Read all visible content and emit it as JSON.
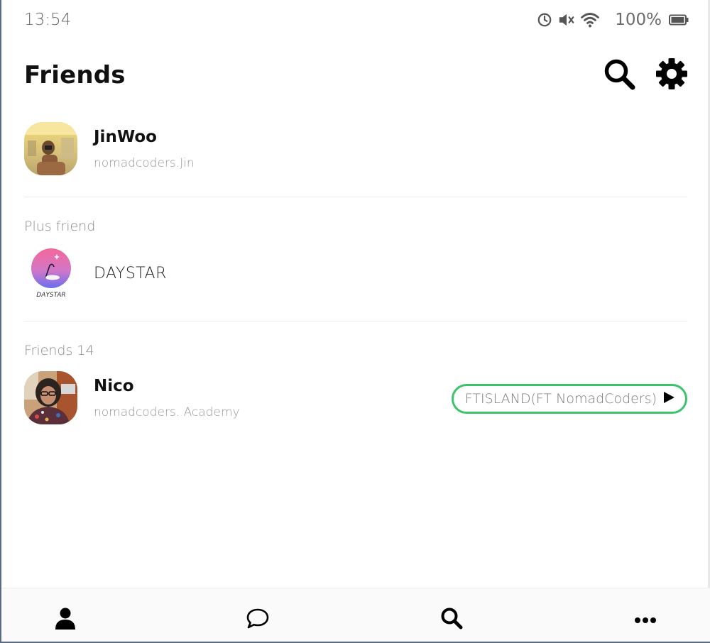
{
  "status_bar": {
    "time": "13:54",
    "battery": "100%",
    "icons": [
      "alarm-icon",
      "mute-icon",
      "wifi-icon",
      "battery-icon"
    ]
  },
  "header": {
    "title": "Friends",
    "actions": [
      "search-icon",
      "gear-icon"
    ]
  },
  "my_profile": {
    "name": "JinWoo",
    "username": "nomadcoders.Jin"
  },
  "plus_friend": {
    "section_title": "Plus friend",
    "items": [
      {
        "name": "DAYSTAR",
        "logo_text": "DAYSTAR"
      }
    ]
  },
  "friends": {
    "section_title": "Friends 14",
    "items": [
      {
        "name": "Nico",
        "status": "nomadcoders. Academy",
        "music": "FTISLAND(FT NomadCoders)"
      }
    ]
  },
  "tab_bar": {
    "tabs": [
      "person-icon",
      "chat-bubble-icon",
      "search-icon",
      "more-icon"
    ]
  },
  "colors": {
    "music_border": "#3cc46a",
    "text_primary": "#111111",
    "text_muted": "#9a9a9a"
  }
}
